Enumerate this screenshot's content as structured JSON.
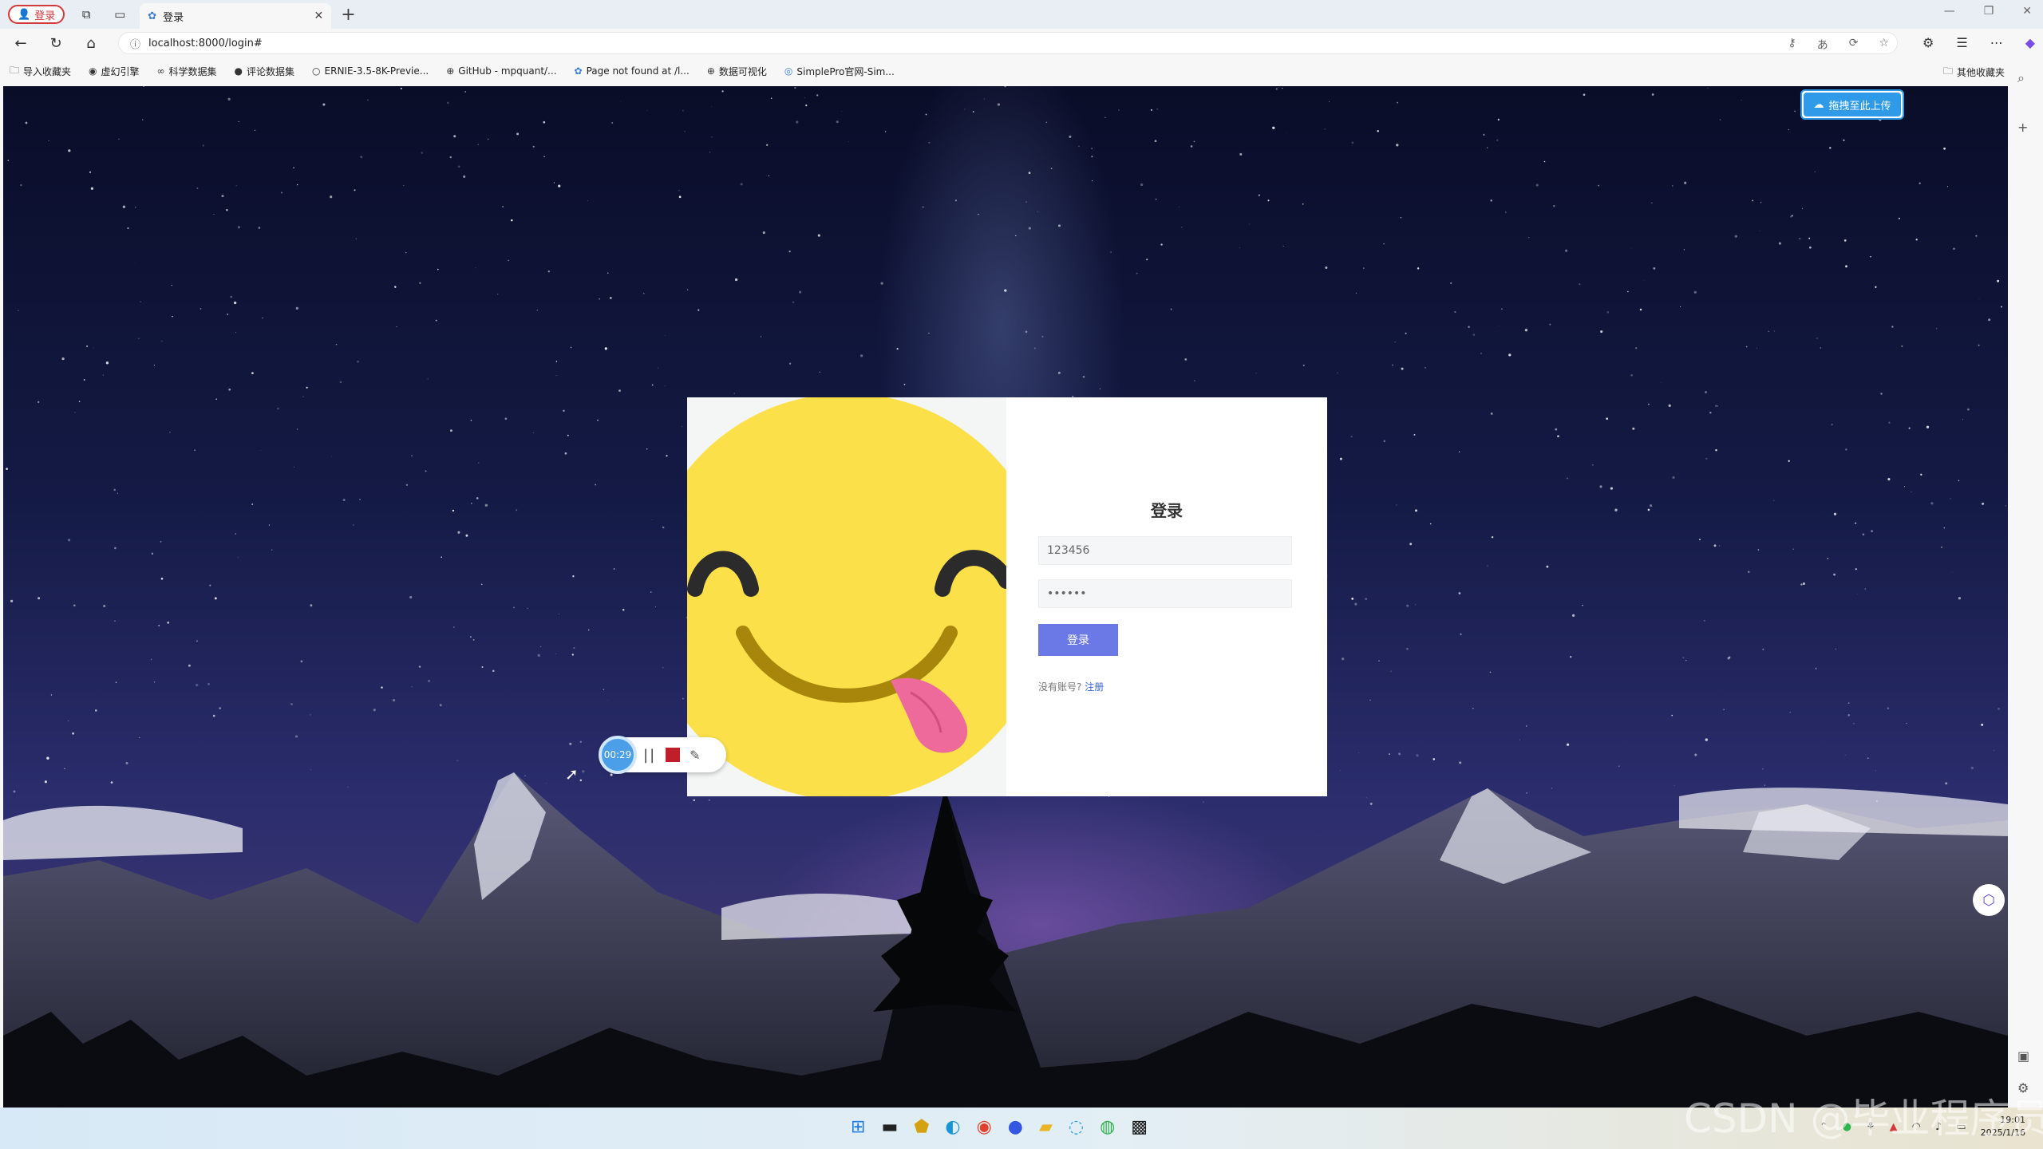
{
  "browser": {
    "profile_label": "登录",
    "tab_title": "登录",
    "url": "localhost:8000/login#"
  },
  "bookmarks": [
    {
      "label": "导入收藏夹",
      "icon": "folder-icon"
    },
    {
      "label": "虚幻引擎",
      "icon": "unreal-icon"
    },
    {
      "label": "科学数据集",
      "icon": "link-icon"
    },
    {
      "label": "评论数据集",
      "icon": "github-icon"
    },
    {
      "label": "ERNIE-3.5-8K-Previe...",
      "icon": "ernie-icon"
    },
    {
      "label": "GitHub - mpquant/...",
      "icon": "globe-icon"
    },
    {
      "label": "Page not found at /l...",
      "icon": "django-icon"
    },
    {
      "label": "数据可视化",
      "icon": "globe-icon"
    },
    {
      "label": "SimplePro官网-Sim...",
      "icon": "simplepro-icon"
    }
  ],
  "bookmarks_other": "其他收藏夹",
  "upload_button": "拖拽至此上传",
  "login": {
    "title": "登录",
    "username_value": "123456",
    "password_value": "••••••",
    "submit_label": "登录",
    "no_account_text": "没有账号?",
    "register_link": "注册"
  },
  "recorder": {
    "time": "00:29"
  },
  "taskbar": {
    "time": "19:01",
    "date": "2025/1/16"
  },
  "watermark": "CSDN @毕业程序员",
  "colors": {
    "accent_button": "#6a79e6",
    "upload_blue": "#2f9be8",
    "profile_red": "#d3383a",
    "smiley_yellow": "#fbe04a"
  }
}
